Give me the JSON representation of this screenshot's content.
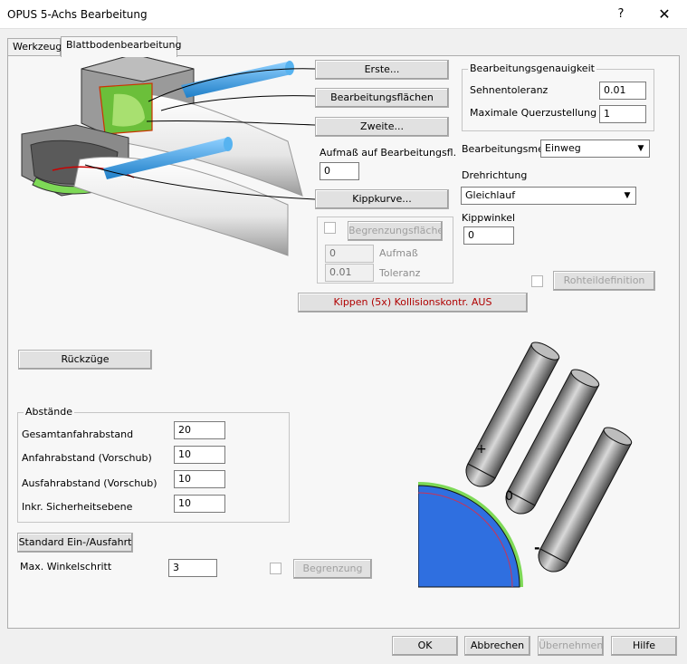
{
  "window": {
    "title": "OPUS 5-Achs Bearbeitung",
    "help": "?",
    "close": "✕"
  },
  "tabs": [
    {
      "label": "Werkzeug"
    },
    {
      "label": "Blattbodenbearbeitung"
    }
  ],
  "diagram_buttons": {
    "erste": "Erste...",
    "flaechen": "Bearbeitungsflächen",
    "zweite": "Zweite...",
    "kippkurve": "Kippkurve..."
  },
  "allowance": {
    "label": "Aufmaß auf Bearbeitungsfl.",
    "value": "0"
  },
  "boundary": {
    "button": "Begrenzungsflächen",
    "aufmass_value": "0",
    "aufmass_label": "Aufmaß",
    "toleranz_value": "0.01",
    "toleranz_label": "Toleranz"
  },
  "accuracy": {
    "title": "Bearbeitungsgenauigkeit",
    "sehnentoleranz_label": "Sehnentoleranz",
    "sehnentoleranz_value": "0.01",
    "querzustellung_label": "Maximale Querzustellung",
    "querzustellung_value": "1"
  },
  "method": {
    "label": "Bearbeitungsme",
    "value": "Einweg"
  },
  "direction": {
    "label": "Drehrichtung",
    "value": "Gleichlauf"
  },
  "tilt": {
    "label": "Kippwinkel",
    "value": "0"
  },
  "rohteil": {
    "button": "Rohteildefinition"
  },
  "collision": {
    "button": "Kippen (5x) Kollisionskontr. AUS"
  },
  "rueckzuege": {
    "button": "Rückzüge"
  },
  "distances": {
    "title": "Abstände",
    "rows": [
      {
        "label": "Gesamtanfahrabstand",
        "value": "20"
      },
      {
        "label": "Anfahrabstand (Vorschub)",
        "value": "10"
      },
      {
        "label": "Ausfahrabstand (Vorschub)",
        "value": "10"
      },
      {
        "label": "Inkr. Sicherheitsebene",
        "value": "10"
      }
    ]
  },
  "standard": {
    "button": "Standard Ein-/Ausfahrt"
  },
  "angle": {
    "label": "Max. Winkelschritt",
    "value": "3"
  },
  "begrenzung": {
    "button": "Begrenzung"
  },
  "tool_diagram": {
    "plus": "+",
    "zero": "0",
    "minus": "-"
  },
  "footer": {
    "ok": "OK",
    "cancel": "Abbrechen",
    "apply": "Übernehmen",
    "help": "Hilfe"
  },
  "colors": {
    "accent_red": "#b00000",
    "tool_blue": "#3a9bdc",
    "surface_green": "#7ed957",
    "quarter_blue": "#2f6fe0"
  }
}
